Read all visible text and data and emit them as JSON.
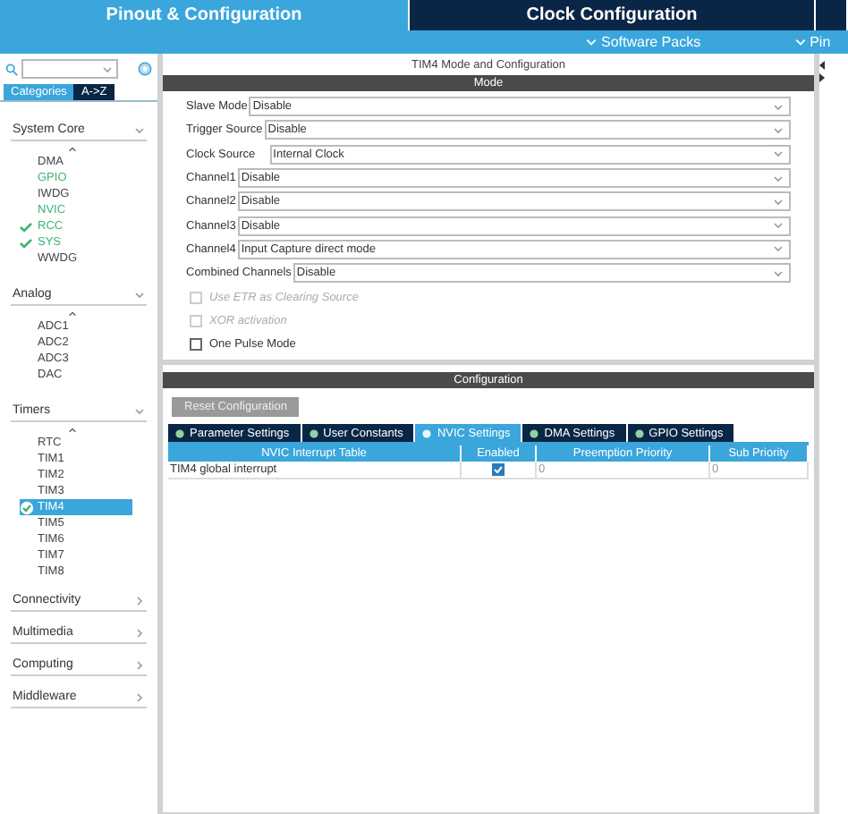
{
  "top_tabs": [
    {
      "label": "Pinout & Configuration",
      "selected": true
    },
    {
      "label": "Clock Configuration",
      "selected": false
    },
    {
      "selected": false
    }
  ],
  "sub_menu": [
    "Software Packs",
    "Pin"
  ],
  "sidebar": {
    "view_tabs": [
      {
        "label": "Categories",
        "selected": true
      },
      {
        "label": "A->Z",
        "selected": false
      }
    ],
    "categories": [
      {
        "name": "System Core",
        "expanded": true,
        "items": [
          {
            "name": "DMA",
            "configured": false,
            "checked": false,
            "selected": false
          },
          {
            "name": "GPIO",
            "configured": true,
            "checked": false,
            "selected": false
          },
          {
            "name": "IWDG",
            "configured": false,
            "checked": false,
            "selected": false
          },
          {
            "name": "NVIC",
            "configured": true,
            "checked": false,
            "selected": false
          },
          {
            "name": "RCC",
            "configured": true,
            "checked": true,
            "selected": false
          },
          {
            "name": "SYS",
            "configured": true,
            "checked": true,
            "selected": false
          },
          {
            "name": "WWDG",
            "configured": false,
            "checked": false,
            "selected": false
          }
        ]
      },
      {
        "name": "Analog",
        "expanded": true,
        "items": [
          {
            "name": "ADC1",
            "configured": false,
            "checked": false,
            "selected": false
          },
          {
            "name": "ADC2",
            "configured": false,
            "checked": false,
            "selected": false
          },
          {
            "name": "ADC3",
            "configured": false,
            "checked": false,
            "selected": false
          },
          {
            "name": "DAC",
            "configured": false,
            "checked": false,
            "selected": false
          }
        ]
      },
      {
        "name": "Timers",
        "expanded": true,
        "items": [
          {
            "name": "RTC",
            "configured": false,
            "checked": false,
            "selected": false
          },
          {
            "name": "TIM1",
            "configured": false,
            "checked": false,
            "selected": false
          },
          {
            "name": "TIM2",
            "configured": false,
            "checked": false,
            "selected": false
          },
          {
            "name": "TIM3",
            "configured": false,
            "checked": false,
            "selected": false
          },
          {
            "name": "TIM4",
            "configured": true,
            "checked": true,
            "selected": true
          },
          {
            "name": "TIM5",
            "configured": false,
            "checked": false,
            "selected": false
          },
          {
            "name": "TIM6",
            "configured": false,
            "checked": false,
            "selected": false
          },
          {
            "name": "TIM7",
            "configured": false,
            "checked": false,
            "selected": false
          },
          {
            "name": "TIM8",
            "configured": false,
            "checked": false,
            "selected": false
          }
        ]
      },
      {
        "name": "Connectivity",
        "expanded": false
      },
      {
        "name": "Multimedia",
        "expanded": false
      },
      {
        "name": "Computing",
        "expanded": false
      },
      {
        "name": "Middleware",
        "expanded": false
      }
    ]
  },
  "panel": {
    "title": "TIM4 Mode and Configuration",
    "mode_header": "Mode",
    "fields": [
      {
        "kind": "select",
        "label": "Slave Mode",
        "value": "Disable"
      },
      {
        "kind": "select",
        "label": "Trigger Source",
        "value": "Disable"
      },
      {
        "kind": "select",
        "label": "Clock Source",
        "value": "Internal Clock"
      },
      {
        "kind": "select",
        "label": "Channel1",
        "value": "Disable"
      },
      {
        "kind": "select",
        "label": "Channel2",
        "value": "Disable"
      },
      {
        "kind": "select",
        "label": "Channel3",
        "value": "Disable"
      },
      {
        "kind": "select",
        "label": "Channel4",
        "value": "Input Capture direct mode"
      },
      {
        "kind": "select",
        "label": "Combined Channels",
        "value": "Disable"
      },
      {
        "kind": "checkbox",
        "label": "Use ETR as Clearing Source",
        "checked": false,
        "disabled": true
      },
      {
        "kind": "checkbox",
        "label": "XOR activation",
        "checked": false,
        "disabled": true
      },
      {
        "kind": "checkbox",
        "label": "One Pulse Mode",
        "checked": false,
        "disabled": false
      }
    ],
    "config_header": "Configuration",
    "reset_button": "Reset Configuration",
    "config_tabs": [
      {
        "label": "Parameter Settings",
        "selected": false
      },
      {
        "label": "User Constants",
        "selected": false
      },
      {
        "label": "NVIC Settings",
        "selected": true
      },
      {
        "label": "DMA Settings",
        "selected": false
      },
      {
        "label": "GPIO Settings",
        "selected": false
      }
    ],
    "table": {
      "columns": [
        "NVIC Interrupt Table",
        "Enabled",
        "Preemption Priority",
        "Sub Priority"
      ],
      "rows": [
        {
          "name": "TIM4 global interrupt",
          "enabled": true,
          "preemption": "0",
          "sub": "0"
        }
      ]
    }
  }
}
